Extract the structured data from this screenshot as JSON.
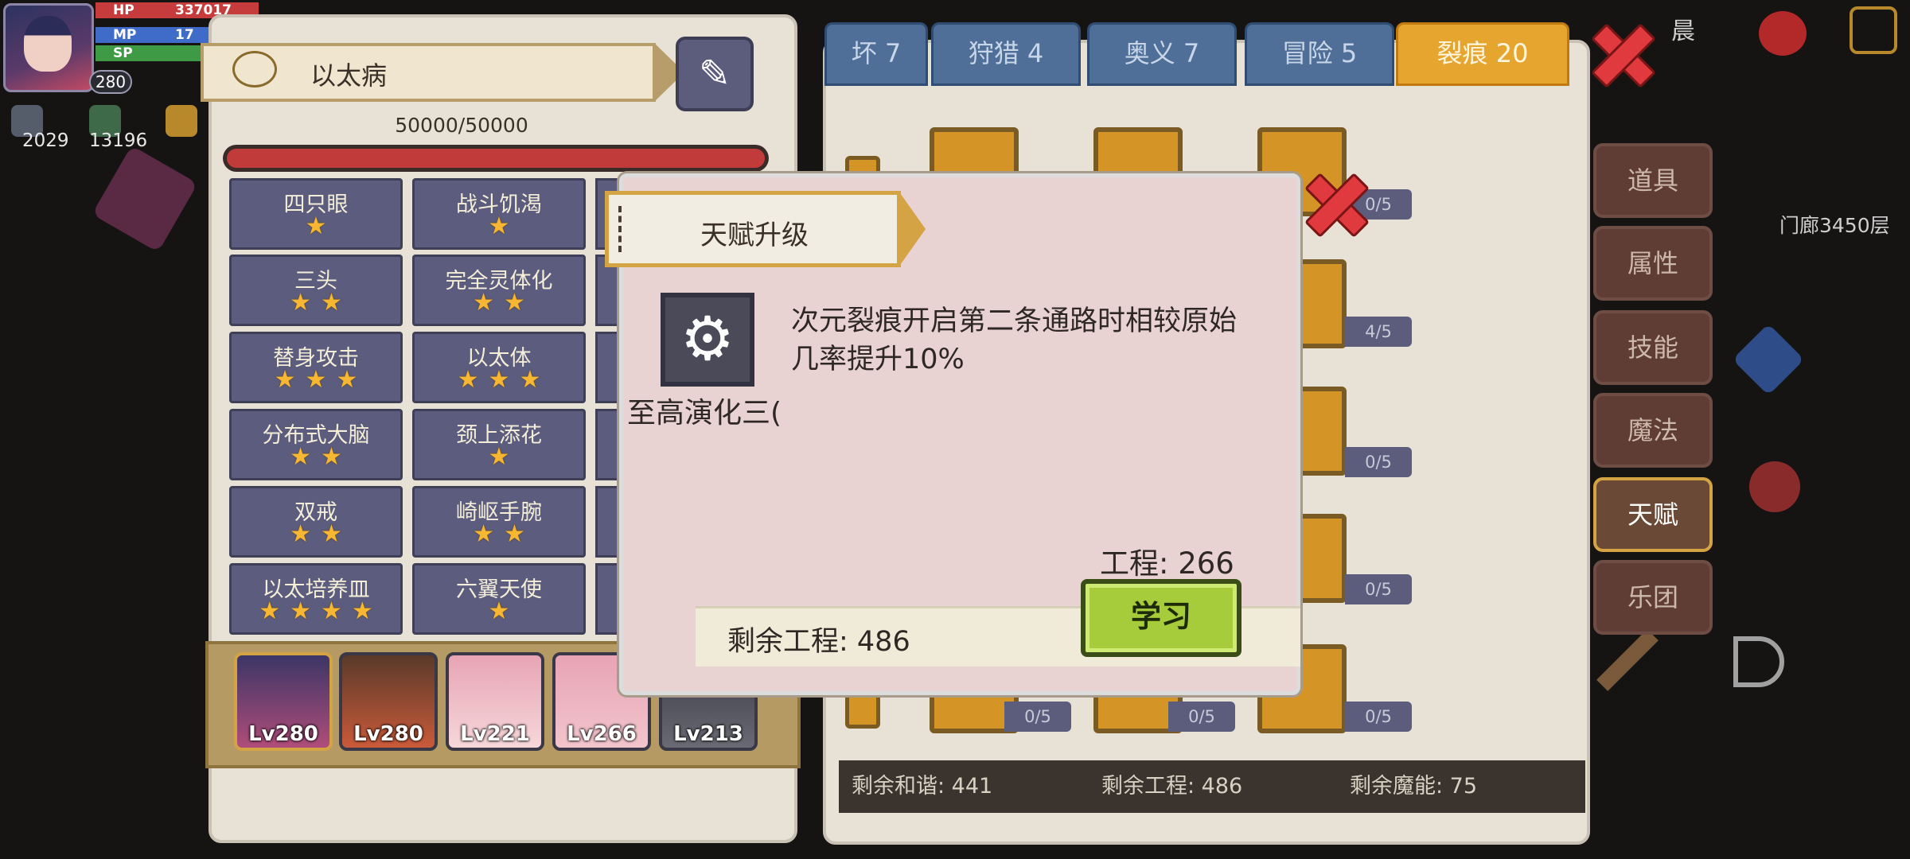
{
  "hud": {
    "hp_label": "HP",
    "hp_value": "337017",
    "mp_label": "MP",
    "mp_value": "17",
    "sp_label": "SP",
    "level": "280",
    "resource_1": "2029",
    "resource_2": "13196"
  },
  "left_panel": {
    "disease_title": "以太病",
    "exp_text": "50000/50000",
    "talents": [
      [
        {
          "name": "四只眼",
          "stars": "★"
        },
        {
          "name": "战斗饥渴",
          "stars": "★"
        }
      ],
      [
        {
          "name": "三头",
          "stars": "★★"
        },
        {
          "name": "完全灵体化",
          "stars": "★★"
        }
      ],
      [
        {
          "name": "替身攻击",
          "stars": "★★★"
        },
        {
          "name": "以太体",
          "stars": "★★★"
        }
      ],
      [
        {
          "name": "分布式大脑",
          "stars": "★★"
        },
        {
          "name": "颈上添花",
          "stars": "★"
        }
      ],
      [
        {
          "name": "双戒",
          "stars": "★★"
        },
        {
          "name": "崎岖手腕",
          "stars": "★★"
        }
      ],
      [
        {
          "name": "以太培养皿",
          "stars": "★★★★"
        },
        {
          "name": "六翼天使",
          "stars": "★"
        }
      ]
    ],
    "team": [
      "Lv280",
      "Lv280",
      "Lv221",
      "Lv266",
      "Lv213"
    ]
  },
  "right_panel": {
    "tabs": [
      "坏 7",
      "狩猎 4",
      "奥义 7",
      "冒险 5",
      "裂痕 20"
    ],
    "node_counts": [
      "0/5",
      "4/5",
      "0/5",
      "0/5",
      "0/5",
      "0/5",
      "0/5"
    ],
    "status": {
      "harmony": "剩余和谐: 441",
      "engineering": "剩余工程: 486",
      "magic": "剩余魔能: 75"
    }
  },
  "side_menu": [
    "道具",
    "属性",
    "技能",
    "魔法",
    "天赋",
    "乐团"
  ],
  "right_info": {
    "floor": "门廊3450层",
    "top_text": "晨"
  },
  "modal": {
    "title": "天赋升级",
    "skill_name": "至高演化三(",
    "description": "次元裂痕开启第二条通路时相较原始几率提升10%",
    "cost": "工程: 266",
    "remaining": "剩余工程:  486",
    "learn_label": "学习"
  },
  "colors": {
    "accent_gold": "#d4a343",
    "learn_green": "#a6cc3c",
    "close_red": "#e03a3f",
    "tab_blue": "#4f6f98"
  }
}
